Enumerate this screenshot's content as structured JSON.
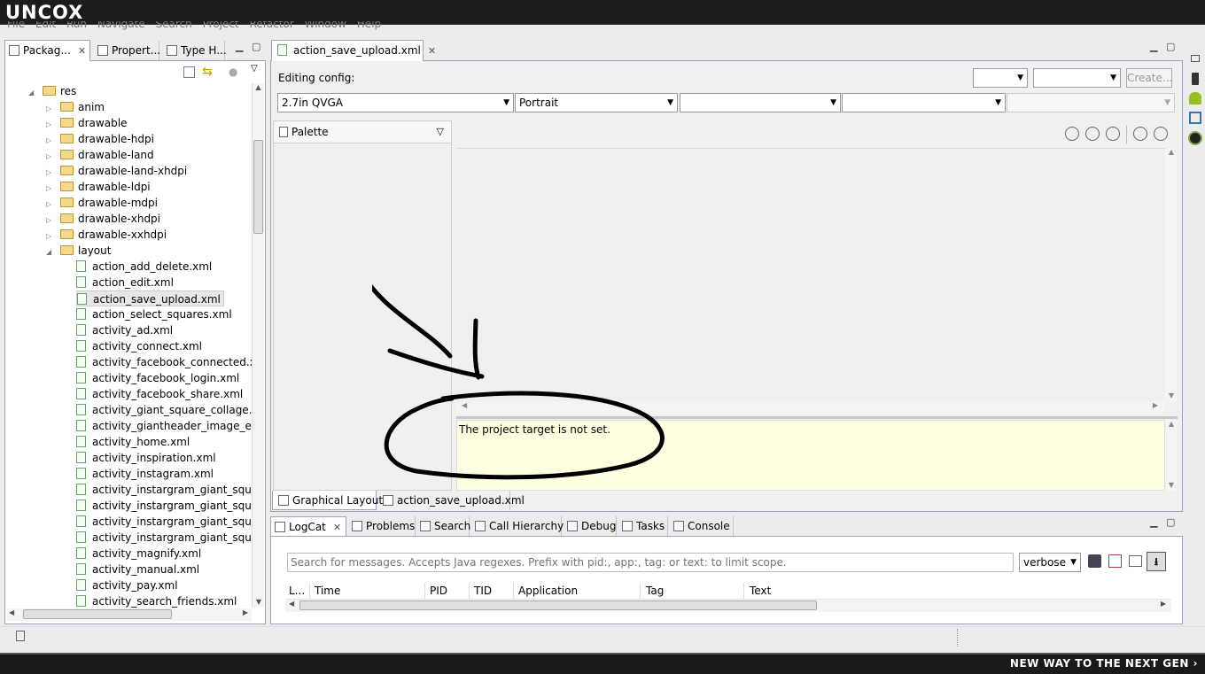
{
  "brand": {
    "logo": "UNCOX",
    "tagline": "NEW WAY TO THE NEXT GEN ›"
  },
  "menu": [
    "File",
    "Edit",
    "Run",
    "Navigate",
    "Search",
    "Project",
    "Refactor",
    "Window",
    "Help"
  ],
  "left_tabs": {
    "package": "Packag...",
    "properties": "Propert...",
    "type_hierarchy": "Type H..."
  },
  "tree": {
    "root": "res",
    "folders": [
      "anim",
      "drawable",
      "drawable-hdpi",
      "drawable-land",
      "drawable-land-xhdpi",
      "drawable-ldpi",
      "drawable-mdpi",
      "drawable-xhdpi",
      "drawable-xxhdpi"
    ],
    "layout": "layout",
    "files": [
      "action_add_delete.xml",
      "action_edit.xml",
      "action_save_upload.xml",
      "action_select_squares.xml",
      "activity_ad.xml",
      "activity_connect.xml",
      "activity_facebook_connected.xml",
      "activity_facebook_login.xml",
      "activity_facebook_share.xml",
      "activity_giant_square_collage.xml",
      "activity_giantheader_image_editc",
      "activity_home.xml",
      "activity_inspiration.xml",
      "activity_instagram.xml",
      "activity_instargram_giant_square_",
      "activity_instargram_giant_square_",
      "activity_instargram_giant_square_",
      "activity_instargram_giant_square.",
      "activity_magnify.xml",
      "activity_manual.xml",
      "activity_pay.xml",
      "activity_search_friends.xml"
    ]
  },
  "editor": {
    "tab": "action_save_upload.xml",
    "editing_config": "Editing config:",
    "create_button": "Create...",
    "device": "2.7in QVGA",
    "orientation": "Portrait",
    "palette": "Palette",
    "message": "The project target is not set.",
    "bottom_tabs": {
      "graphical": "Graphical Layout",
      "xml": "action_save_upload.xml"
    }
  },
  "console_tabs": [
    "LogCat",
    "Problems",
    "Search",
    "Call Hierarchy",
    "Debug",
    "Tasks",
    "Console"
  ],
  "logcat": {
    "search_placeholder": "Search for messages. Accepts Java regexes. Prefix with pid:, app:, tag: or text: to limit scope.",
    "level": "verbose",
    "columns": [
      "L...",
      "Time",
      "PID",
      "TID",
      "Application",
      "Tag",
      "Text"
    ]
  }
}
